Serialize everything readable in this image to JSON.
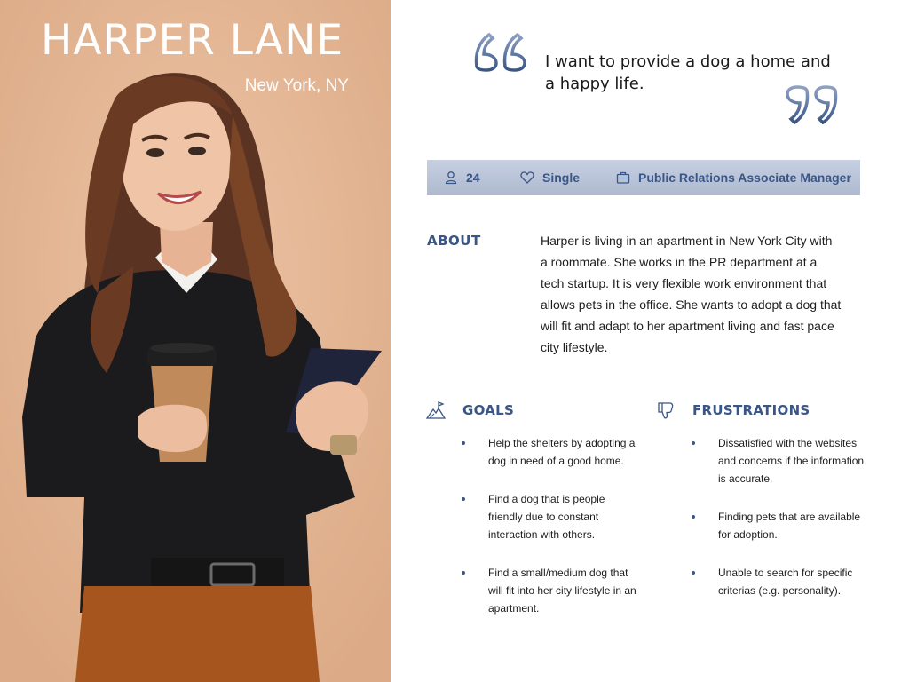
{
  "persona": {
    "name": "HARPER LANE",
    "location": "New York, NY"
  },
  "quote": {
    "text": "I want to provide a dog a home and a happy life."
  },
  "info_bar": {
    "age": "24",
    "status": "Single",
    "occupation": "Public Relations Associate Manager",
    "icons": [
      "user-icon",
      "heart-icon",
      "briefcase-icon"
    ]
  },
  "about": {
    "heading": "ABOUT",
    "text": "Harper is living in an apartment in New York City with a roommate. She works in the PR department at a tech startup. It is very flexible work environment that allows pets in the office. She wants to adopt a dog that will fit and adapt to her apartment living and fast pace city lifestyle."
  },
  "goals": {
    "heading": "GOALS",
    "items": [
      "Help the shelters by adopting a dog in need of a good home.",
      "Find a dog that is people friendly due to constant interaction with others.",
      "Find a small/medium dog that will fit into her city lifestyle in an apartment."
    ]
  },
  "frustrations": {
    "heading": "FRUSTRATIONS",
    "items": [
      "Dissatisfied with the websites and concerns if the information is accurate.",
      "Finding pets that are available for adoption.",
      "Unable to search for specific criterias (e.g. personality)."
    ]
  },
  "colors": {
    "accent": "#3a5687",
    "left_panel_bg": "#e3b391",
    "info_bar_bg": "#b8c3d8"
  }
}
